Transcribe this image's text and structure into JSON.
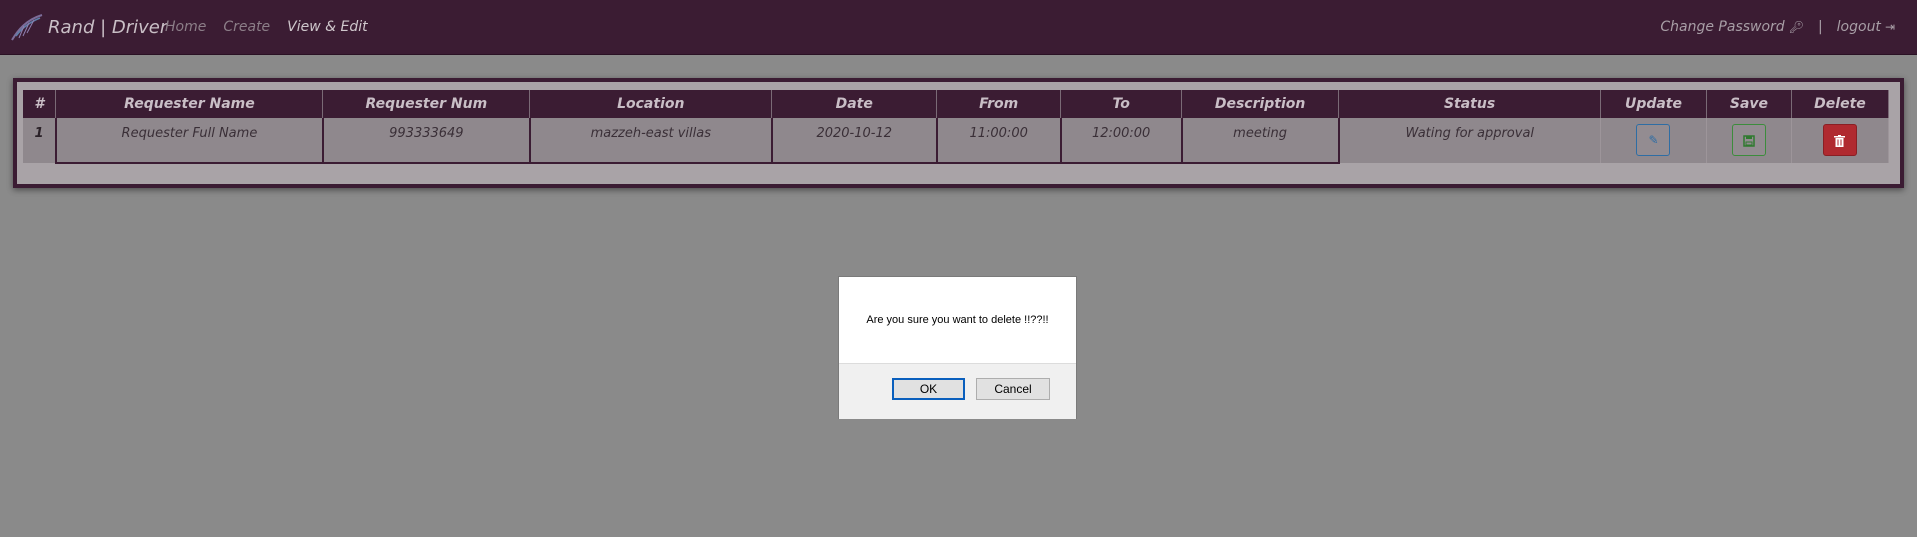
{
  "navbar": {
    "brand": "Rand | Driver",
    "links": [
      "Home",
      "Create",
      "View & Edit"
    ],
    "change_password": "Change Password",
    "separator": "|",
    "logout": "logout"
  },
  "table": {
    "headers": [
      "#",
      "Requester Name",
      "Requester Num",
      "Location",
      "Date",
      "From",
      "To",
      "Description",
      "Status",
      "Update",
      "Save",
      "Delete"
    ],
    "rows": [
      {
        "index": "1",
        "requester_name": "Requester Full Name",
        "requester_num": "993333649",
        "location": "mazzeh-east villas",
        "date": "2020-10-12",
        "from": "11:00:00",
        "to": "12:00:00",
        "description": "meeting",
        "status": "Wating for approval"
      }
    ]
  },
  "dialog": {
    "message": "Are you sure you want to delete !!??!!",
    "ok_label": "OK",
    "cancel_label": "Cancel"
  },
  "icons": {
    "update": "edit-icon",
    "save": "save-icon",
    "delete": "trash-icon",
    "change_password": "key-icon",
    "logout": "sign-out-icon"
  },
  "colors": {
    "navbar_bg": "#3b1c33",
    "overlay_bg": "#8a8a8a",
    "update_btn": "#2e6da4",
    "save_btn": "#3c8c3c",
    "delete_btn": "#b02a30"
  }
}
